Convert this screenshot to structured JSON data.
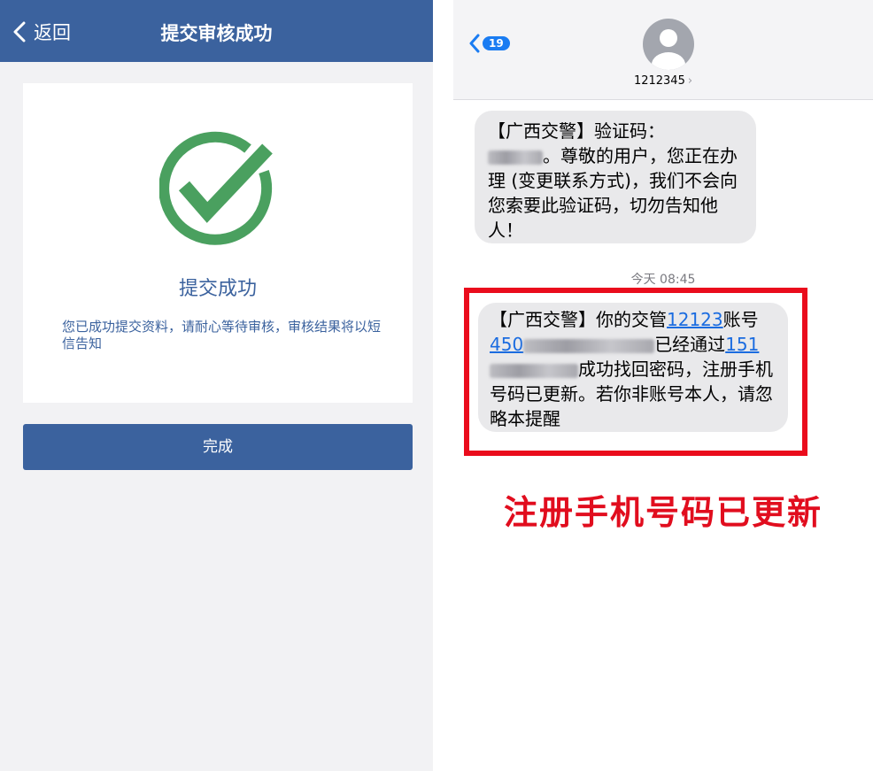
{
  "left": {
    "header": {
      "back_label": "返回",
      "title": "提交审核成功"
    },
    "result": {
      "title": "提交成功",
      "description": "您已成功提交资料，请耐心等待审核，审核结果将以短信告知"
    },
    "done_button": "完成",
    "colors": {
      "primary": "#3b629e",
      "success": "#4aa05f",
      "background": "#f2f2f4"
    },
    "icons": {
      "back": "chevron-left-icon",
      "success": "check-circle-icon"
    }
  },
  "right": {
    "header": {
      "unread_count": "19",
      "contact_number": "1212345",
      "contact_chevron": "›"
    },
    "messages": [
      {
        "sender_tag": "【广西交警】",
        "text_prefix": "验证码：",
        "text_after_code": "。尊敬的用户，您正在办理 (变更联系方式)，我们不会向您索要此验证码，切勿告知他人！"
      },
      {
        "timestamp_day": "今天",
        "timestamp_time": "08:45",
        "sender_tag": "【广西交警】",
        "part1": "你的交管",
        "app_link": "12123",
        "part2": "账号",
        "account_visible": "450",
        "part3": "已经通过",
        "phone_visible": "151",
        "part4": "成功找回密码，注册手机号码已更新。若你非账号本人，请忽略本提醒"
      }
    ],
    "annotation_caption": "注册手机号码已更新",
    "colors": {
      "link": "#1b6ce0",
      "bubble": "#e9e9eb",
      "highlight": "#ea0c1c",
      "badge": "#1a7cf2"
    },
    "icons": {
      "back": "chevron-left-icon",
      "avatar": "person-avatar-icon"
    }
  }
}
